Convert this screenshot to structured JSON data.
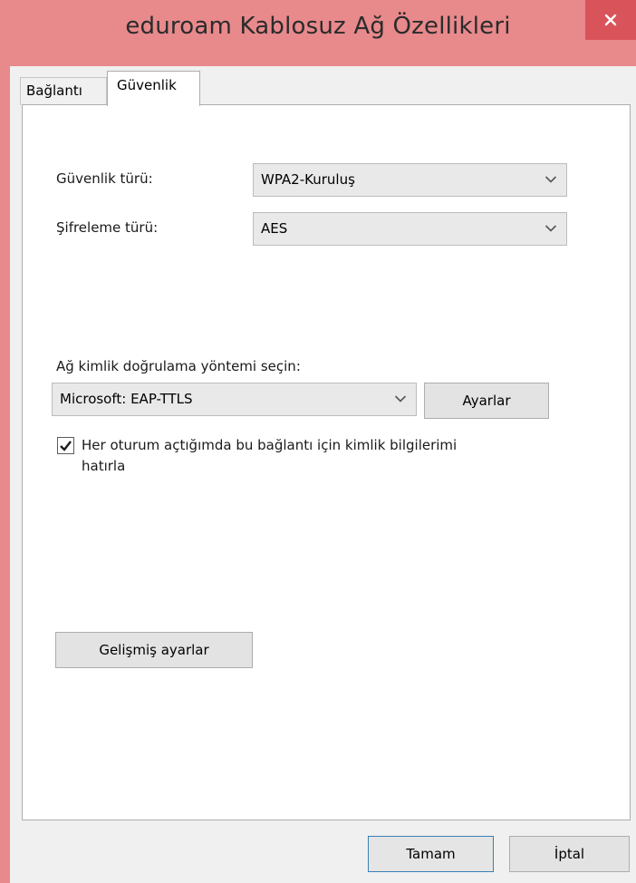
{
  "window": {
    "title": "eduroam Kablosuz Ağ Özellikleri",
    "close_icon": "close-icon",
    "accent_color": "#e8898c",
    "close_color": "#d9535a"
  },
  "tabs": [
    {
      "label": "Bağlantı",
      "active": false
    },
    {
      "label": "Güvenlik",
      "active": true
    }
  ],
  "security": {
    "type_label": "Güvenlik türü:",
    "type_value": "WPA2-Kuruluş",
    "encryption_label": "Şifreleme türü:",
    "encryption_value": "AES"
  },
  "auth": {
    "method_label": "Ağ kimlik doğrulama yöntemi seçin:",
    "method_value": "Microsoft: EAP-TTLS",
    "settings_button": "Ayarlar",
    "remember_checked": true,
    "remember_label": "Her oturum açtığımda bu bağlantı için kimlik bilgilerimi hatırla"
  },
  "advanced_button": "Gelişmiş ayarlar",
  "footer": {
    "ok_button": "Tamam",
    "cancel_button": "İptal"
  }
}
